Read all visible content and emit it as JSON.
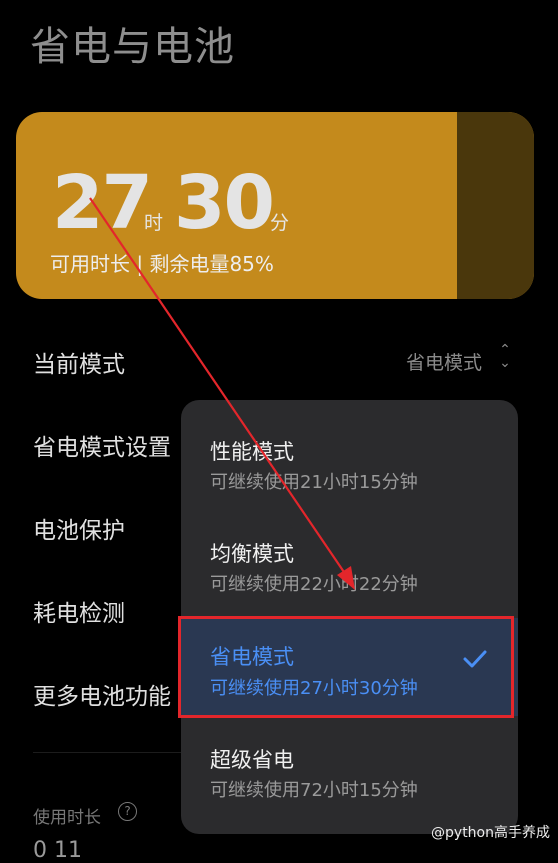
{
  "page": {
    "title": "省电与电池"
  },
  "battery": {
    "hours": "27",
    "hours_unit": "时",
    "minutes": "30",
    "minutes_unit": "分",
    "subtitle": "可用时长 | 剩余电量85%",
    "level_percent": 85
  },
  "settings": {
    "current_mode_label": "当前模式",
    "current_mode_value": "省电模式",
    "rows": [
      "省电模式设置",
      "电池保护",
      "耗电检测",
      "更多电池功能"
    ]
  },
  "usage": {
    "label": "使用时长",
    "help": "?",
    "value_stub": "0 11"
  },
  "dropdown": {
    "options": [
      {
        "title": "性能模式",
        "subtitle": "可继续使用21小时15分钟",
        "selected": false
      },
      {
        "title": "均衡模式",
        "subtitle": "可继续使用22小时22分钟",
        "selected": false
      },
      {
        "title": "省电模式",
        "subtitle": "可继续使用27小时30分钟",
        "selected": true
      },
      {
        "title": "超级省电",
        "subtitle": "可继续使用72小时15分钟",
        "selected": false
      }
    ]
  },
  "watermark": "@python高手养成",
  "colors": {
    "battery_fill": "#c48a1c",
    "battery_empty": "#4a370c",
    "accent_blue": "#4a8ff5",
    "annotation_red": "#e3262b"
  }
}
